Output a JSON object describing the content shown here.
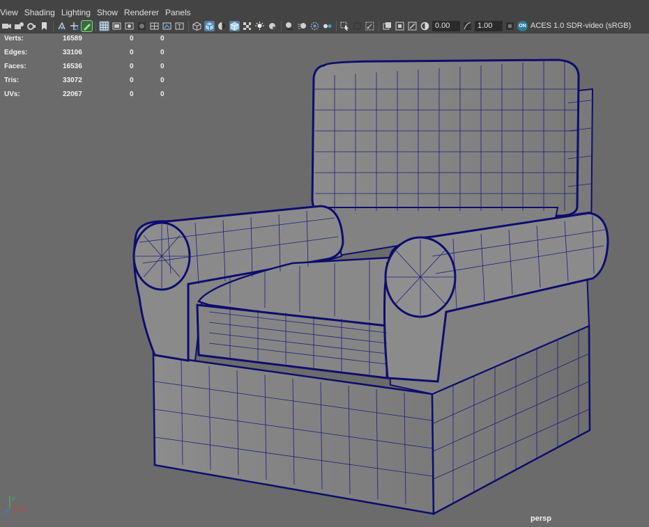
{
  "menu": {
    "items": [
      "View",
      "Shading",
      "Lighting",
      "Show",
      "Renderer",
      "Panels"
    ]
  },
  "toolbar": {
    "exposure_value": "0.00",
    "gamma_value": "1.00",
    "color_management_badge": "ON",
    "color_space": "ACES 1.0 SDR-video (sRGB)",
    "icons": [
      "camera-select-icon",
      "camera-attr-icon",
      "bookmark-icon",
      "image-plane-icon",
      "2d-pan-zoom-icon",
      "grease-pencil-icon",
      "grid-icon",
      "film-gate-icon",
      "resolution-gate-icon",
      "gate-mask-icon",
      "field-chart-icon",
      "safe-action-icon",
      "safe-title-icon",
      "wireframe-icon",
      "smooth-shade-icon",
      "default-material-icon",
      "wireframe-on-shaded-icon",
      "textured-icon",
      "use-all-lights-icon",
      "shadows-icon",
      "screen-space-ao-icon",
      "motion-blur-icon",
      "multisample-aa-icon",
      "depth-of-field-icon",
      "isolate-select-icon",
      "xray-icon",
      "xray-joints-icon",
      "xray-components-icon",
      "exposure-icon",
      "gamma-icon",
      "color-management-icon"
    ]
  },
  "hud": {
    "rows": [
      {
        "label": "Verts:",
        "v1": "16589",
        "v2": "0",
        "v3": "0"
      },
      {
        "label": "Edges:",
        "v1": "33106",
        "v2": "0",
        "v3": "0"
      },
      {
        "label": "Faces:",
        "v1": "16536",
        "v2": "0",
        "v3": "0"
      },
      {
        "label": "Tris:",
        "v1": "33072",
        "v2": "0",
        "v3": "0"
      },
      {
        "label": "UVs:",
        "v1": "22067",
        "v2": "0",
        "v3": "0"
      }
    ]
  },
  "viewport": {
    "camera": "persp",
    "background_color": "#6b6b6b",
    "wire_color": "#0d0d6e",
    "surface_color": "#8a8a8a"
  },
  "axis": {
    "x": "x",
    "y": "y",
    "z": "z"
  }
}
